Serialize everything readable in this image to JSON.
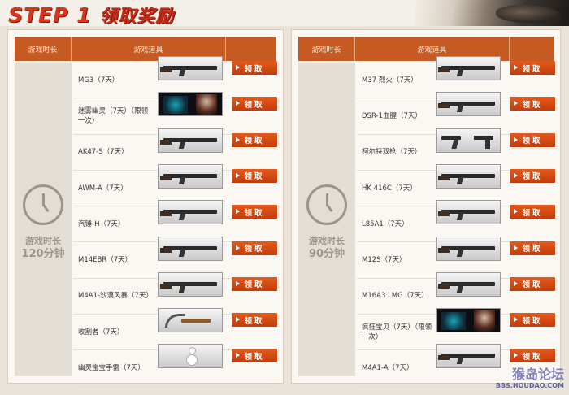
{
  "header": {
    "step": "STEP 1",
    "title": "领取奖励"
  },
  "columns": {
    "time": "游戏时长",
    "item": "游戏道具"
  },
  "button_label": "领取",
  "left": {
    "time_prefix": "游戏时长",
    "time_value": "120分钟",
    "items": [
      {
        "name": "MG3（7天）"
      },
      {
        "name": "迷雾幽灵（7天）（限领一次）"
      },
      {
        "name": "AK47-S（7天）"
      },
      {
        "name": "AWM-A（7天）"
      },
      {
        "name": "汽锤-H（7天）"
      },
      {
        "name": "M14EBR（7天）"
      },
      {
        "name": "M4A1-沙漠风暴（7天）"
      },
      {
        "name": "收割者（7天）"
      },
      {
        "name": "幽灵宝宝手雷（7天）"
      }
    ]
  },
  "right": {
    "time_prefix": "游戏时长",
    "time_value": "90分钟",
    "items": [
      {
        "name": "M37 烈火（7天）"
      },
      {
        "name": "DSR-1血腥（7天）"
      },
      {
        "name": "柯尔特双枪（7天）"
      },
      {
        "name": "HK 416C（7天）"
      },
      {
        "name": "L85A1（7天）"
      },
      {
        "name": "M12S（7天）"
      },
      {
        "name": "M16A3 LMG（7天）"
      },
      {
        "name": "疯狂宝贝（7天）（限领一次）"
      },
      {
        "name": "M4A1-A（7天）"
      }
    ]
  },
  "watermark": {
    "main": "猴岛论坛",
    "sub": "BBS.HOUDAO.COM"
  }
}
